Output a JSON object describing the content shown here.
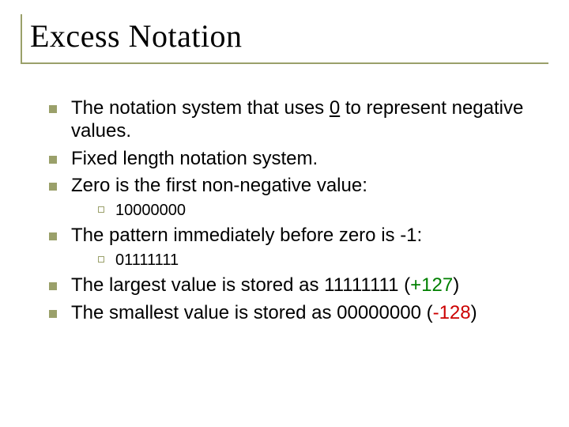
{
  "title": "Excess Notation",
  "bullets": {
    "b1_pre": "The notation system that uses ",
    "b1_underlined": "0",
    "b1_post": " to represent negative values.",
    "b2": "Fixed length notation system.",
    "b3": "Zero is the first non-negative value:",
    "b3_sub1": "10000000",
    "b4": "The pattern immediately before zero is -1:",
    "b4_sub1": "01111111",
    "b5_pre": "The largest value is stored as 11111111 (",
    "b5_green": "+127",
    "b5_post": ")",
    "b6_pre": "The smallest value is stored as 00000000 (",
    "b6_red": "-128",
    "b6_post": ")"
  }
}
